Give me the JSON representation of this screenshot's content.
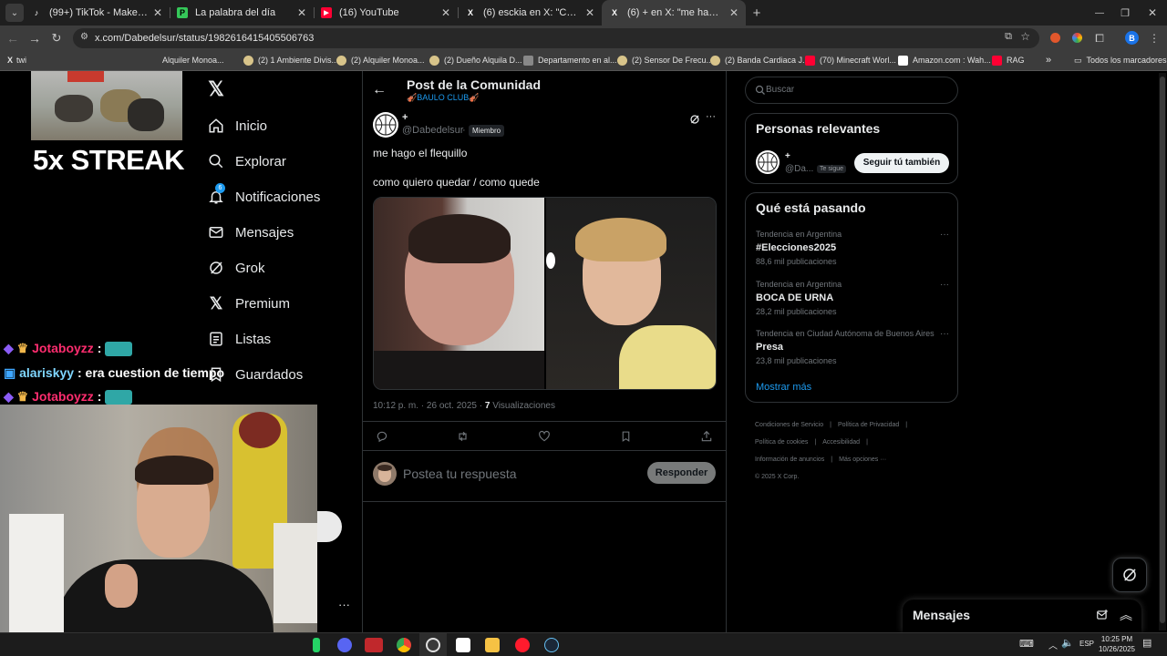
{
  "browser": {
    "tabs": [
      {
        "title": "(99+) TikTok - Make Your Day",
        "color": "#000000",
        "glyph": "♪"
      },
      {
        "title": "La palabra del día",
        "color": "#35c759",
        "glyph": "P"
      },
      {
        "title": "(16) YouTube",
        "color": "#ff0033",
        "glyph": "▶"
      },
      {
        "title": "(6) esckia en X: \"Cooked https:/",
        "color": "#000000",
        "glyph": "X"
      },
      {
        "title": "(6) + en X: \"me hago el flequillo",
        "color": "#000000",
        "glyph": "X"
      }
    ],
    "url": "x.com/Dabedelsur/status/1982616415405506763",
    "bookmarks": [
      {
        "label": "twi"
      },
      {
        "label": "Alquiler Monoa..."
      },
      {
        "label": "(2) 1 Ambiente Divis..."
      },
      {
        "label": "(2) Alquiler Monoa..."
      },
      {
        "label": "(2) Dueño Alquila D..."
      },
      {
        "label": "Departamento en al..."
      },
      {
        "label": "(2) Sensor De Frecu..."
      },
      {
        "label": "(2) Banda Cardiaca J..."
      },
      {
        "label": "(70) Minecraft Worl..."
      },
      {
        "label": "Amazon.com : Wah..."
      },
      {
        "label": "RAG"
      }
    ],
    "all_bookmarks": "Todos los marcadores",
    "profile_initial": "B"
  },
  "stream": {
    "streak": "5x STREAK",
    "chat": [
      {
        "user": "Jotaboyzz",
        "sep": ":",
        "msg": "",
        "color": "#ff2d6f"
      },
      {
        "user": "alariskyy",
        "sep": ":",
        "msg": "era cuestion de tiempo",
        "color": "#7fd6ff"
      },
      {
        "user": "Jotaboyzz",
        "sep": ":",
        "msg": "",
        "color": "#ff2d6f"
      }
    ]
  },
  "nav": {
    "items": [
      {
        "label": "Inicio"
      },
      {
        "label": "Explorar"
      },
      {
        "label": "Notificaciones"
      },
      {
        "label": "Mensajes"
      },
      {
        "label": "Grok"
      },
      {
        "label": "Premium"
      },
      {
        "label": "Listas"
      },
      {
        "label": "Guardados"
      }
    ],
    "notif_badge": "6"
  },
  "post": {
    "header_title": "Post de la Comunidad",
    "community": "🎻BAULO CLUB🎻",
    "author_name": "+",
    "author_handle": "@Dabedelsur",
    "role_badge": "Miembro",
    "text_line1": "me hago el flequillo",
    "text_line2": "como quiero quedar / como quede",
    "timestamp": "10:12 p. m. · 26 oct. 2025 ·",
    "views_count": "7",
    "views_label": "Visualizaciones",
    "reply_placeholder": "Postea tu respuesta",
    "reply_button": "Responder"
  },
  "sidebar": {
    "search_placeholder": "Buscar",
    "relevant_title": "Personas relevantes",
    "relevant_name": "+",
    "relevant_handle": "@Da...",
    "follows_you": "Te sigue",
    "follow_button": "Seguir tú también",
    "trends_title": "Qué está pasando",
    "trends": [
      {
        "meta": "Tendencia en Argentina",
        "name": "#Elecciones2025",
        "count": "88,6 mil publicaciones"
      },
      {
        "meta": "Tendencia en Argentina",
        "name": "BOCA DE URNA",
        "count": "28,2 mil publicaciones"
      },
      {
        "meta": "Tendencia en Ciudad Autónoma de Buenos Aires",
        "name": "Presa",
        "count": "23,8 mil publicaciones"
      }
    ],
    "show_more": "Mostrar más",
    "footer": {
      "terms": "Condiciones de Servicio",
      "privacy": "Política de Privacidad",
      "cookies": "Política de cookies",
      "accessibility": "Accesibilidad",
      "ads": "Información de anuncios",
      "more": "Más opciones ···",
      "copyright": "© 2025 X Corp."
    },
    "messages_title": "Mensajes"
  },
  "taskbar": {
    "time": "10:25 PM",
    "date": "10/26/2025",
    "lang": "ESP"
  },
  "colors": {
    "accent": "#1d9bf0",
    "background": "#000000",
    "border": "#2f3336"
  }
}
